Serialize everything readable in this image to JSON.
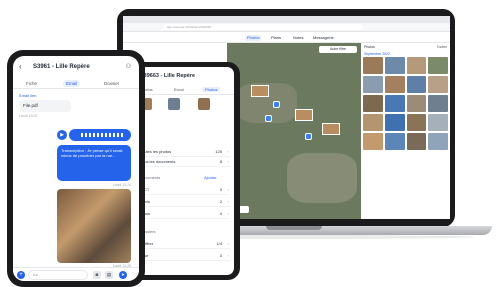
{
  "phone": {
    "title": "S3961 - Lille Repère",
    "back_icon": "‹",
    "user_icon": "⚇",
    "tabs": [
      "Fiche",
      "Email",
      "Dossier"
    ],
    "mail_label": "Email lien",
    "file_name": "File.pdf",
    "file_meta": "Lundi 13:02",
    "play_icon": "▶",
    "transcription": "Transcription : Je pense qu'il serait mieux de procéder par la rue...",
    "transcription_time": "Lundi 13:24",
    "photo_time": "Lundi 13:28",
    "input_placeholder": "Aa",
    "plus_icon": "+"
  },
  "tablet": {
    "title": "S39663 - Lille Repère",
    "tabs": [
      "Infos",
      "Envoi",
      "Photos"
    ],
    "rows": [
      {
        "label": "Toutes les photos",
        "value": "125"
      },
      {
        "label": "Tous les documents",
        "value": "8"
      }
    ],
    "section_docs": "Documents",
    "section_action": "Ajouter",
    "doc_rows": [
      {
        "label": "DICT",
        "value": "3"
      },
      {
        "label": "Devis",
        "value": "2"
      },
      {
        "label": "Plans",
        "value": "4"
      }
    ],
    "section_other": "Dossiers",
    "other_rows": [
      {
        "label": "Chiffrer",
        "value": "1/4"
      },
      {
        "label": "Mise",
        "value": "3"
      }
    ]
  },
  "laptop": {
    "url": "app.exemple.fr/chantiers/S39663",
    "toolbar": [
      "Photos",
      "Plans",
      "Notes",
      "Messagerie"
    ],
    "map_filter": "Autre filtre",
    "gallery_head": "Photos",
    "gallery_tab": "Toutes",
    "gallery_title": "Septembre 2022"
  }
}
